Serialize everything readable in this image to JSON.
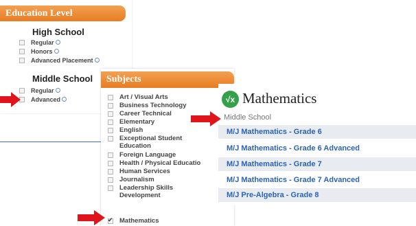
{
  "education": {
    "header": "Education Level",
    "high_school": {
      "title": "High School",
      "items": [
        {
          "label": "Regular",
          "checked": false
        },
        {
          "label": "Honors",
          "checked": false
        },
        {
          "label": "Advanced Placement",
          "checked": false
        }
      ]
    },
    "middle_school": {
      "title": "Middle School",
      "items": [
        {
          "label": "Regular",
          "checked": false
        },
        {
          "label": "Advanced",
          "checked": false
        }
      ]
    }
  },
  "subjects": {
    "header": "Subjects",
    "items": [
      {
        "label": "Art / Visual Arts",
        "checked": false
      },
      {
        "label": "Business Technology",
        "checked": false
      },
      {
        "label": "Career Technical",
        "checked": false
      },
      {
        "label": "Elementary",
        "checked": false
      },
      {
        "label": "English",
        "checked": false
      },
      {
        "label": "Exceptional Student Education",
        "checked": false
      },
      {
        "label": "Foreign Language",
        "checked": false
      },
      {
        "label": "Health / Physical Educatio",
        "checked": false
      },
      {
        "label": "Human Services",
        "checked": false
      },
      {
        "label": "Journalism",
        "checked": false
      },
      {
        "label": "Leadership Skills Development",
        "checked": false
      },
      {
        "label": "Mathematics",
        "checked": true
      }
    ]
  },
  "mathematics": {
    "logo_text": "√x",
    "title": "Mathematics",
    "section": "Middle School",
    "courses": [
      "M/J Mathematics - Grade 6",
      "M/J Mathematics - Grade 6 Advanced",
      "M/J Mathematics - Grade 7",
      "M/J Mathematics - Grade 7 Advanced",
      "M/J Pre-Algebra - Grade 8"
    ]
  },
  "colors": {
    "header_orange": "#e77d22",
    "arrow_red": "#e0141b",
    "link_blue": "#2a62b8",
    "logo_green": "#35a04a",
    "connector_blue": "#3a6fc4"
  }
}
